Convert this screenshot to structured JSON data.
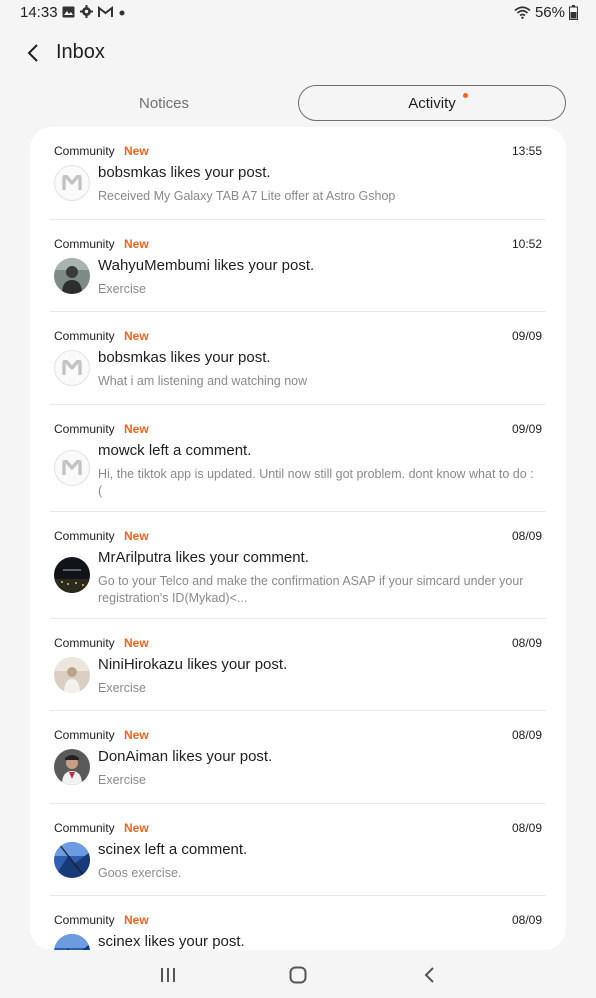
{
  "status_bar": {
    "time": "14:33",
    "battery": "56%",
    "icons": [
      "gallery-icon",
      "gear-icon",
      "gmail-icon",
      "dot-icon",
      "wifi-icon",
      "battery-icon"
    ]
  },
  "header": {
    "title": "Inbox"
  },
  "tabs": [
    {
      "label": "Notices",
      "selected": false
    },
    {
      "label": "Activity",
      "selected": true,
      "has_dot": true
    }
  ],
  "colors": {
    "accent": "#f0641e",
    "background": "#f5f5f5",
    "card": "#ffffff"
  },
  "items": [
    {
      "source": "Community",
      "badge": "New",
      "time": "13:55",
      "title": "bobsmkas likes your post.",
      "subtitle": "Received My Galaxy TAB A7 Lite offer at Astro Gshop",
      "avatar": "members-logo"
    },
    {
      "source": "Community",
      "badge": "New",
      "time": "10:52",
      "title": "WahyuMembumi likes your post.",
      "subtitle": "Exercise",
      "avatar": "photo"
    },
    {
      "source": "Community",
      "badge": "New",
      "time": "09/09",
      "title": "bobsmkas likes your post.",
      "subtitle": "What i am listening and watching now",
      "avatar": "members-logo"
    },
    {
      "source": "Community",
      "badge": "New",
      "time": "09/09",
      "title": "mowck left a comment.",
      "subtitle": "Hi, the tiktok app is updated. Until now still got problem. dont know what to do :(",
      "avatar": "members-logo"
    },
    {
      "source": "Community",
      "badge": "New",
      "time": "08/09",
      "title": "MrArilputra likes your comment.",
      "subtitle": "Go to your Telco and make the confirmation ASAP if your simcard under your registration's ID(Mykad)<...",
      "avatar": "photo"
    },
    {
      "source": "Community",
      "badge": "New",
      "time": "08/09",
      "title": "NiniHirokazu likes your post.",
      "subtitle": "Exercise",
      "avatar": "photo"
    },
    {
      "source": "Community",
      "badge": "New",
      "time": "08/09",
      "title": "DonAiman likes your post.",
      "subtitle": "Exercise",
      "avatar": "photo"
    },
    {
      "source": "Community",
      "badge": "New",
      "time": "08/09",
      "title": "scinex left a comment.",
      "subtitle": "Goos exercise.",
      "avatar": "photo"
    },
    {
      "source": "Community",
      "badge": "New",
      "time": "08/09",
      "title": "scinex likes your post.",
      "subtitle": "",
      "avatar": "photo"
    }
  ]
}
